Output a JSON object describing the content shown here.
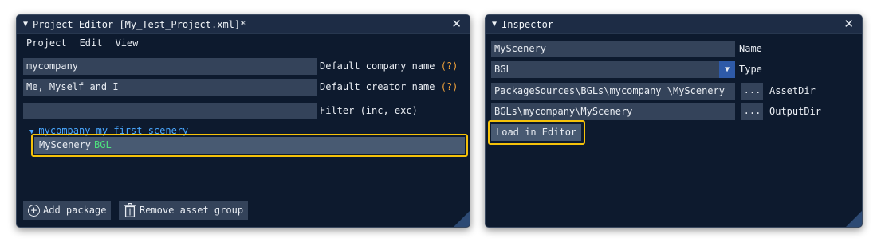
{
  "project_editor": {
    "title": "Project Editor [My_Test_Project.xml]",
    "modified_marker": "*",
    "menu": [
      "Project",
      "Edit",
      "View"
    ],
    "company_value": "mycompany",
    "company_label": "Default company name",
    "creator_value": "Me, Myself and I",
    "creator_label": "Default creator name",
    "help_marker": "(?)",
    "filter_value": "",
    "filter_label": "Filter (inc,-exc)",
    "tree_group": "mycompany-my-first-scenery",
    "selected_asset": "MyScenery",
    "selected_asset_type": "BGL",
    "add_package_label": "Add package",
    "remove_group_label": "Remove asset group"
  },
  "inspector": {
    "title": "Inspector",
    "name_value": "MyScenery",
    "name_label": "Name",
    "type_value": "BGL",
    "type_label": "Type",
    "assetdir_value": "PackageSources\\BGLs\\mycompany \\MyScenery",
    "assetdir_label": "AssetDir",
    "outputdir_value": "BGLs\\mycompany\\MyScenery",
    "outputdir_label": "OutputDir",
    "browse_label": "...",
    "load_button_label": "Load in Editor"
  },
  "colors": {
    "window_bg": "#0d1a2e",
    "field_bg": "#34435a",
    "highlight": "#f5c20a",
    "help": "#f0a13a",
    "tree_link": "#4aa8ff",
    "asset_type": "#4ee27e"
  },
  "icons": [
    "expand-triangle-icon",
    "close-icon",
    "add-circle-icon",
    "trash-icon",
    "dropdown-arrow-icon",
    "resize-grip-icon"
  ]
}
